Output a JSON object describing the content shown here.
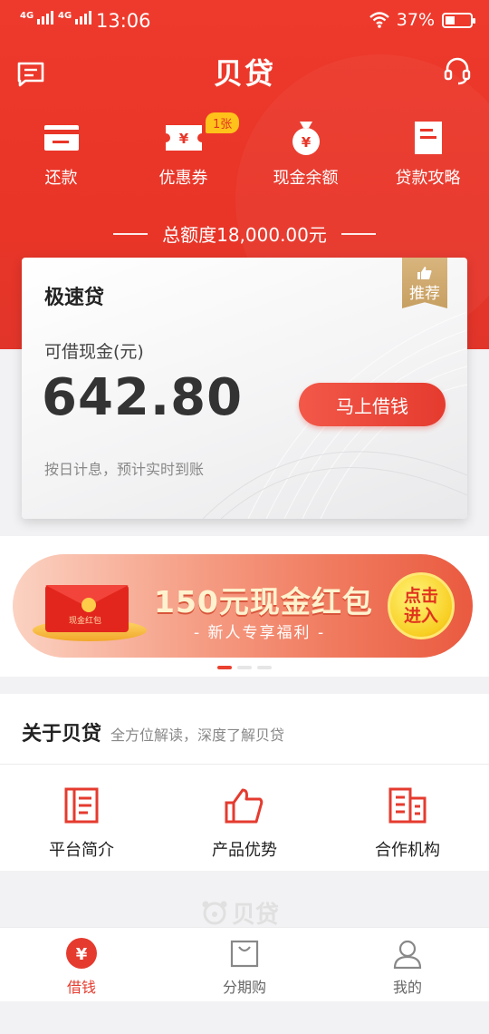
{
  "status_bar": {
    "signal1": "4G",
    "signal2": "4G",
    "time": "13:06",
    "battery": "37%",
    "battery_level": 0.37
  },
  "header": {
    "logo": "贝贷",
    "left_icon": "message-icon",
    "right_icon": "headset-icon"
  },
  "quick_actions": [
    {
      "label": "还款",
      "icon": "card-icon"
    },
    {
      "label": "优惠券",
      "icon": "coupon-icon",
      "badge": "1张"
    },
    {
      "label": "现金余额",
      "icon": "money-bag-icon"
    },
    {
      "label": "贷款攻略",
      "icon": "document-icon"
    }
  ],
  "total_quota": "总额度18,000.00元",
  "loan_card": {
    "title": "极速贷",
    "recommend": "推荐",
    "available_label": "可借现金(元)",
    "amount": "642.80",
    "button": "马上借钱",
    "note": "按日计息，预计实时到账"
  },
  "banner": {
    "main_text": "150元现金红包",
    "sub_text": "- 新人专享福利 -",
    "button_line1": "点击",
    "button_line2": "进入",
    "envelope_text": "现金红包",
    "page_index": 1,
    "page_count": 3
  },
  "about": {
    "title": "关于贝贷",
    "desc": "全方位解读，深度了解贝贷",
    "items": [
      {
        "label": "平台简介",
        "icon": "document-icon"
      },
      {
        "label": "产品优势",
        "icon": "thumbs-up-icon"
      },
      {
        "label": "合作机构",
        "icon": "building-icon"
      }
    ]
  },
  "footer_logo": "贝贷",
  "tabs": [
    {
      "label": "借钱",
      "icon": "yuan-icon",
      "active": true
    },
    {
      "label": "分期购",
      "icon": "shopping-bag-icon",
      "active": false
    },
    {
      "label": "我的",
      "icon": "user-icon",
      "active": false
    }
  ],
  "colors": {
    "brand_red": "#e93528",
    "gold": "#c79f62",
    "badge_yellow": "#ffc21a"
  }
}
